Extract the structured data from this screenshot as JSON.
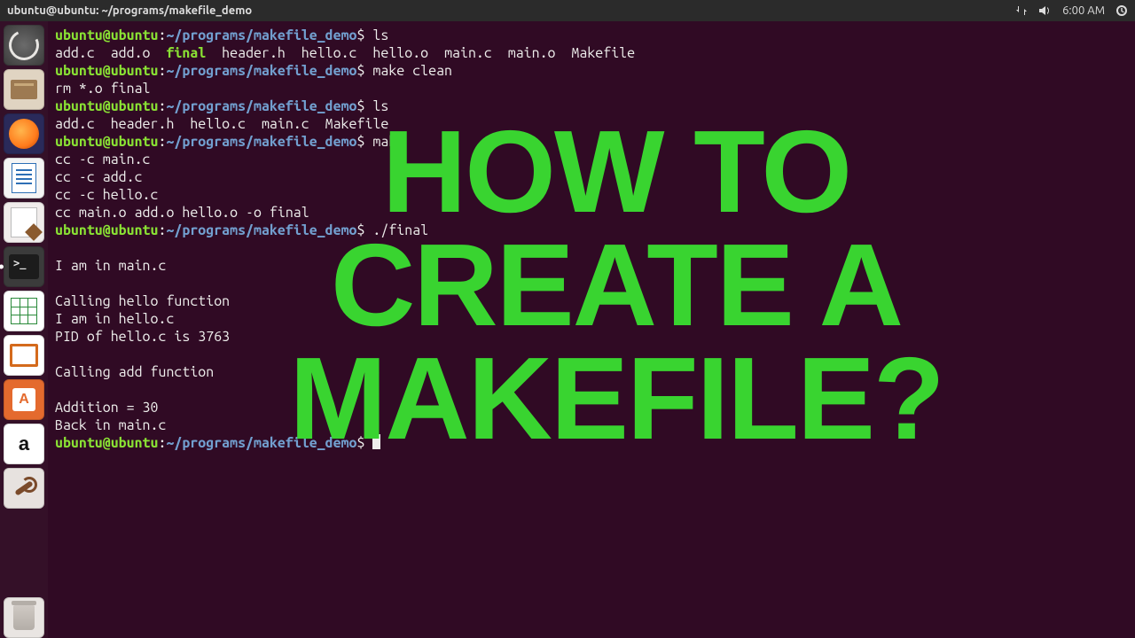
{
  "top_panel": {
    "title": "ubuntu@ubuntu: ~/programs/makefile_demo",
    "clock": "6:00 AM"
  },
  "launcher": {
    "items": [
      {
        "name": "dash-icon",
        "interactable": true
      },
      {
        "name": "files-icon",
        "interactable": true
      },
      {
        "name": "firefox-icon",
        "interactable": true
      },
      {
        "name": "writer-icon",
        "interactable": true
      },
      {
        "name": "text-editor-icon",
        "interactable": true
      },
      {
        "name": "terminal-icon",
        "interactable": true,
        "running": true
      },
      {
        "name": "calc-icon",
        "interactable": true
      },
      {
        "name": "impress-icon",
        "interactable": true
      },
      {
        "name": "software-icon",
        "interactable": true
      },
      {
        "name": "amazon-icon",
        "interactable": true
      },
      {
        "name": "settings-icon",
        "interactable": true
      },
      {
        "name": "trash-icon",
        "interactable": true
      }
    ]
  },
  "prompt": {
    "user_host": "ubuntu@ubuntu",
    "colon": ":",
    "path": "~/programs/makefile_demo",
    "dollar": "$ "
  },
  "terminal": {
    "lines": [
      {
        "type": "prompt",
        "cmd": "ls"
      },
      {
        "type": "ls1_a",
        "text": "add.c  add.o  "
      },
      {
        "type": "ls1_exec",
        "text": "final"
      },
      {
        "type": "ls1_b",
        "text": "  header.h  hello.c  hello.o  main.c  main.o  Makefile"
      },
      {
        "type": "prompt",
        "cmd": "make clean"
      },
      {
        "type": "out",
        "text": "rm *.o final"
      },
      {
        "type": "prompt",
        "cmd": "ls"
      },
      {
        "type": "out",
        "text": "add.c  header.h  hello.c  main.c  Makefile"
      },
      {
        "type": "prompt",
        "cmd": "make"
      },
      {
        "type": "out",
        "text": "cc -c main.c"
      },
      {
        "type": "out",
        "text": "cc -c add.c"
      },
      {
        "type": "out",
        "text": "cc -c hello.c"
      },
      {
        "type": "out",
        "text": "cc main.o add.o hello.o -o final"
      },
      {
        "type": "prompt",
        "cmd": "./final"
      },
      {
        "type": "out",
        "text": " "
      },
      {
        "type": "out",
        "text": "I am in main.c"
      },
      {
        "type": "out",
        "text": " "
      },
      {
        "type": "out",
        "text": "Calling hello function"
      },
      {
        "type": "out",
        "text": "I am in hello.c"
      },
      {
        "type": "out",
        "text": "PID of hello.c is 3763"
      },
      {
        "type": "out",
        "text": " "
      },
      {
        "type": "out",
        "text": "Calling add function"
      },
      {
        "type": "out",
        "text": " "
      },
      {
        "type": "out",
        "text": "Addition = 30"
      },
      {
        "type": "out",
        "text": "Back in main.c"
      },
      {
        "type": "prompt_cursor",
        "cmd": ""
      }
    ]
  },
  "overlay": {
    "line1": "HOW TO",
    "line2": "CREATE A",
    "line3": "MAKEFILE?"
  }
}
